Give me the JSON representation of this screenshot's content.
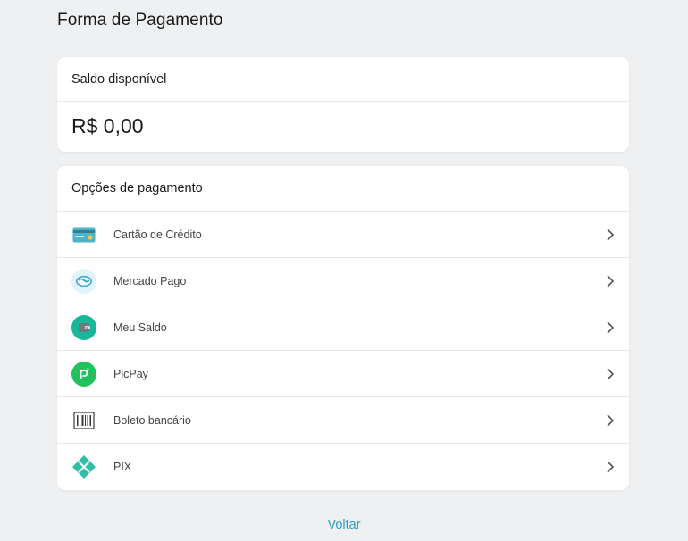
{
  "page": {
    "title": "Forma de Pagamento"
  },
  "balance": {
    "label": "Saldo disponível",
    "value": "R$ 0,00"
  },
  "payment_options": {
    "title": "Opções de pagamento",
    "items": [
      {
        "label": "Cartão de Crédito",
        "icon": "credit-card-icon"
      },
      {
        "label": "Mercado Pago",
        "icon": "mercado-pago-icon"
      },
      {
        "label": "Meu Saldo",
        "icon": "wallet-icon"
      },
      {
        "label": "PicPay",
        "icon": "picpay-icon"
      },
      {
        "label": "Boleto bancário",
        "icon": "barcode-icon"
      },
      {
        "label": "PIX",
        "icon": "pix-icon"
      }
    ]
  },
  "footer": {
    "back_label": "Voltar"
  },
  "colors": {
    "background": "#eef0f1",
    "card": "#ffffff",
    "accent_link": "#2aa0c8",
    "teal": "#17b89a",
    "picpay_green": "#21c25e"
  }
}
